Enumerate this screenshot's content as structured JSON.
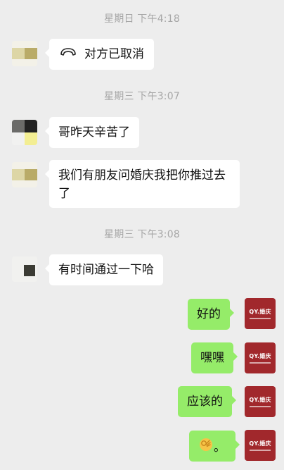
{
  "messages": {
    "time1": "星期日 下午4:18",
    "time2": "星期三 下午3:07",
    "time3": "星期三 下午3:08",
    "call_cancelled": "对方已取消",
    "msg1": "哥昨天辛苦了",
    "msg2": "我们有朋友问婚庆我把你推过去了",
    "msg3": "有时间通过一下哈",
    "reply1": "好的",
    "reply2": "嘿嘿",
    "reply3": "应该的",
    "reply4_suffix": "。"
  },
  "avatar_logo_text": "QY.婚庆",
  "colors": {
    "background": "#ededed",
    "bubble_self": "#95ec69",
    "bubble_other": "#ffffff",
    "timestamp": "#a6a6a6",
    "logo_bg": "#a1282c"
  },
  "icons": {
    "call_cancel": "phone-hangup-icon",
    "ok_hand": "ok-hand-emoji"
  }
}
